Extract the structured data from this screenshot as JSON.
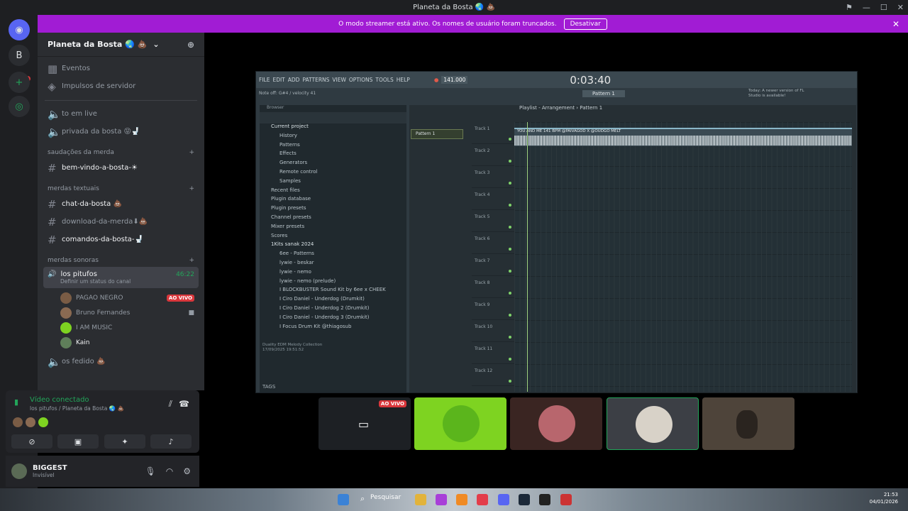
{
  "window": {
    "title": "Planeta da Bosta 🌏 💩"
  },
  "rail": {
    "badge_count": "81"
  },
  "banner": {
    "text": "O modo streamer está ativo. Os nomes de usuário foram truncados.",
    "button": "Desativar"
  },
  "server": {
    "name": "Planeta da Bosta 🌏 💩",
    "top_items": [
      "Eventos",
      "Impulsos de servidor"
    ],
    "channels_a": [
      "to em live",
      "privada da bosta 😝🚽"
    ],
    "categories": [
      "saudações da merda",
      "merdas textuais",
      "merdas sonoras"
    ],
    "welcome": "bem-vindo-a-bosta-☀",
    "text_channels": [
      "chat-da-bosta 💩",
      "download-da-merda⬇💩",
      "comandos-da-bosta-🚽"
    ],
    "voice_channel": {
      "name": "los pitufos",
      "time": "46:22",
      "status": "Definir um status do canal"
    },
    "voice_users": [
      {
        "name": "PAGAO NEGRO",
        "live": "AO VIVO"
      },
      {
        "name": "Bruno Fernandes"
      },
      {
        "name": "I AM MUSIC"
      },
      {
        "name": "Kain"
      }
    ],
    "other_voice": "os fedido 💩"
  },
  "voice_panel": {
    "status": "Vídeo conectado",
    "location": "los pitufos / Planeta da Bosta 🌏 💩"
  },
  "user_panel": {
    "name": "BIGGEST",
    "status": "Invisível"
  },
  "fl": {
    "menu": [
      "FILE",
      "EDIT",
      "ADD",
      "PATTERNS",
      "VIEW",
      "OPTIONS",
      "TOOLS",
      "HELP"
    ],
    "bpm": "141.000",
    "time": "0:03:40",
    "hint": "Note off: G#4 / velocity 41",
    "pattern": "Pattern 1",
    "browser_title": "Browser",
    "browser_items": [
      "Current project",
      "History",
      "Patterns",
      "Effects",
      "Generators",
      "Remote control",
      "Samples",
      "Recent files",
      "Plugin database",
      "Plugin presets",
      "Channel presets",
      "Mixer presets",
      "Scores",
      "1Kits sanak 2024",
      "6ee - Patterns",
      "lywie - beskar",
      "lywie - nemo",
      "lywie - nemo (prelude)",
      "I BLOCKBUSTER Sound Kit by 6ee x CHEEK",
      "I Ciro Daniel - Underdog (Drumkit)",
      "I Ciro Daniel - Underdog 2 (Drumkit)",
      "I Ciro Daniel - Underdog 3 (Drumkit)",
      "I Focus Drum Kit @thiagosub"
    ],
    "meta_title": "Duality EDM Melody Collection",
    "meta_date": "17/09/2025 19:51:52",
    "tags": "TAGS",
    "playlist_title": "Playlist - Arrangement › Pattern 1",
    "pattern_item": "Pattern 1",
    "clip_label": "YOU AND ME 141 BPM @PAIVAGOD X @OUDGO MELT",
    "tracks": [
      "Track 1",
      "Track 2",
      "Track 3",
      "Track 4",
      "Track 5",
      "Track 6",
      "Track 7",
      "Track 8",
      "Track 9",
      "Track 10",
      "Track 11",
      "Track 12"
    ],
    "update_notice": "Today: A newer version of FL Studio is available!"
  },
  "tiles": [
    {
      "live": "AO VIVO"
    },
    {},
    {},
    {},
    {}
  ],
  "taskbar": {
    "search": "Pesquisar",
    "time": "21:53",
    "date": "04/01/2026"
  },
  "colors": {
    "accent_banner": "#a11cd4",
    "live_red": "#da373c",
    "online_green": "#23a55a",
    "tile_green": "#7ed321"
  }
}
